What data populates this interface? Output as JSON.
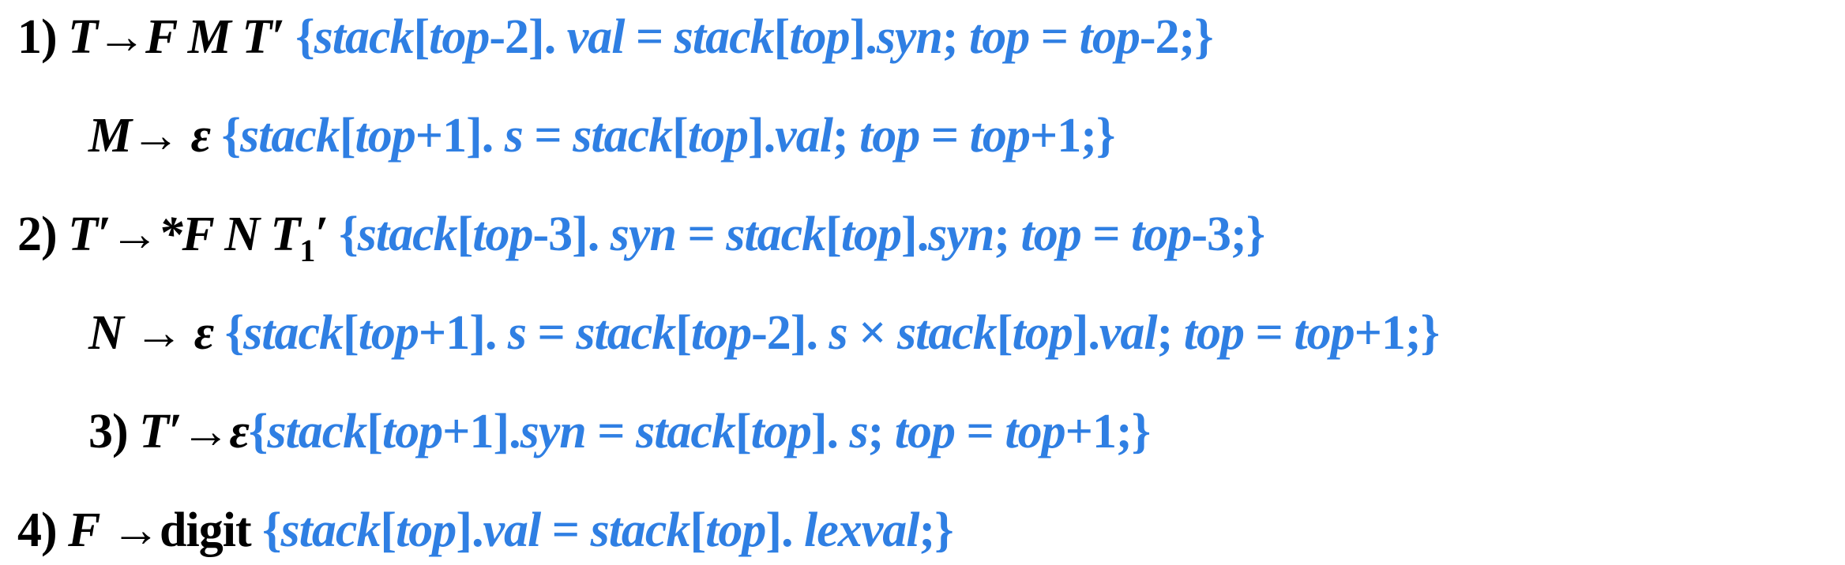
{
  "rules": [
    {
      "head": "1)",
      "production": {
        "lhs": "T",
        "arrow": "→",
        "rhs": "F M T′"
      },
      "action": {
        "open": "{",
        "p1": "stack",
        "p2": "[",
        "p3": "top",
        "p4": "-2]. ",
        "p5": "val",
        "p6": " = ",
        "p7": "stack",
        "p8": "[",
        "p9": "top",
        "p10": "].",
        "p11": "syn",
        "p12": "; ",
        "p13": "top",
        "p14": " = ",
        "p15": "top",
        "p16": "-2;}"
      }
    },
    {
      "production": {
        "lhs": "M",
        "arrow": "→ ",
        "rhs": "ε"
      },
      "action": {
        "p1": "{",
        "p2": "stack",
        "p3": "[",
        "p4": "top",
        "p5": "+1]. ",
        "p6": "s",
        "p7": " = ",
        "p8": "stack",
        "p9": "[",
        "p10": "top",
        "p11": "].",
        "p12": "val",
        "p13": "; ",
        "p14": "top",
        "p15": " = ",
        "p16": "top",
        "p17": "+1;}"
      }
    },
    {
      "head": "2)",
      "production": {
        "lhs": "T′",
        "arrow": "→",
        "rhs_a": "*F N T",
        "rhs_sub": "1",
        "rhs_b": "′"
      },
      "action": {
        "p1": "{",
        "p2": "stack",
        "p3": "[",
        "p4": "top",
        "p5": "-3]. ",
        "p6": "syn",
        "p7": " = ",
        "p8": "stack",
        "p9": "[",
        "p10": "top",
        "p11": "].",
        "p12": "syn",
        "p13": "; ",
        "p14": "top",
        "p15": " = ",
        "p16": "top",
        "p17": "-3;}"
      }
    },
    {
      "production": {
        "lhs": "N",
        "arrow": " → ",
        "rhs": "ε"
      },
      "action": {
        "p1": "{",
        "p2": "stack",
        "p3": "[",
        "p4": "top",
        "p5": "+1]. ",
        "p6": "s",
        "p7": " = ",
        "p8": "stack",
        "p9": "[",
        "p10": "top",
        "p11": "-2]. ",
        "p12": "s",
        "p13": " × ",
        "p14": "stack",
        "p15": "[",
        "p16": "top",
        "p17": "].",
        "p18": "val",
        "p19": "; ",
        "p20": "top",
        "p21": " = ",
        "p22": "top",
        "p23": "+1;}"
      }
    },
    {
      "head": "3)",
      "production": {
        "lhs": "T′",
        "arrow": "→",
        "rhs": "ε"
      },
      "action": {
        "p1": "{",
        "p2": "stack",
        "p3": "[",
        "p4": "top",
        "p5": "+1].",
        "p6": "syn",
        "p7": " = ",
        "p8": "stack",
        "p9": "[",
        "p10": "top",
        "p11": "]. ",
        "p12": "s",
        "p13": "; ",
        "p14": "top",
        "p15": " = ",
        "p16": "top",
        "p17": "+1;}"
      }
    },
    {
      "head": "4)",
      "production": {
        "lhs": "F",
        "arrow": " →",
        "rhs": "digit"
      },
      "action": {
        "p1": "{",
        "p2": "stack",
        "p3": "[",
        "p4": "top",
        "p5": "].",
        "p6": "val",
        "p7": " = ",
        "p8": "stack",
        "p9": "[",
        "p10": "top",
        "p11": "]. ",
        "p12": "lexval",
        "p13": ";}"
      }
    }
  ],
  "colors": {
    "text": "#000000",
    "action": "#2F7FE3",
    "background": "#FFFFFF"
  }
}
